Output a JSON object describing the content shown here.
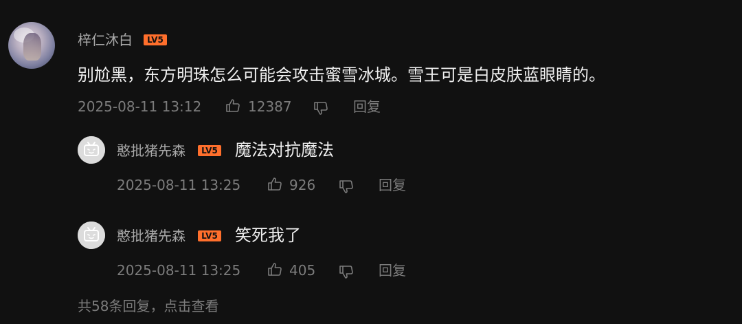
{
  "comment": {
    "username": "梓仁沐白",
    "level": "LV5",
    "text": "别尬黑，东方明珠怎么可能会攻击蜜雪冰城。雪王可是白皮肤蓝眼睛的。",
    "timestamp": "2025-08-11 13:12",
    "likes": "12387",
    "reply_label": "回复"
  },
  "replies": [
    {
      "username": "憨批猪先森",
      "level": "LV5",
      "text": "魔法对抗魔法",
      "timestamp": "2025-08-11 13:25",
      "likes": "926",
      "reply_label": "回复"
    },
    {
      "username": "憨批猪先森",
      "level": "LV5",
      "text": "笑死我了",
      "timestamp": "2025-08-11 13:25",
      "likes": "405",
      "reply_label": "回复"
    }
  ],
  "footer": {
    "view_all_replies": "共58条回复，点击查看"
  },
  "colors": {
    "background": "#111111",
    "level_badge": "#ff6f2c",
    "primary_text": "#efefef",
    "secondary_text": "#7c7c7c"
  },
  "icons": {
    "like": "thumbs-up-icon",
    "dislike": "thumbs-down-icon",
    "default_avatar": "default-avatar-tv-icon"
  }
}
